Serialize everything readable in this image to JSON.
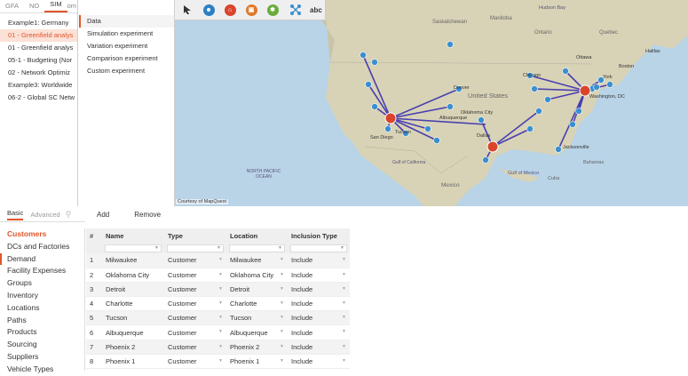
{
  "scenario_panel": {
    "tabs": [
      "GFA",
      "NO",
      "SIM",
      "om"
    ],
    "items": [
      "Example1: Germany",
      "01 - Greenfield analys",
      "01 - Greenfield analys",
      "05-1 - Budgeting (Nor",
      "02 - Network Optimiz",
      "Example3: Worldwide",
      "06-2 - Global SC Netw"
    ]
  },
  "experiments": [
    "Data",
    "Simulation experiment",
    "Variation experiment",
    "Comparison experiment",
    "Custom experiment"
  ],
  "map": {
    "toolbar_text": "abc",
    "courtesy": "Courtesy of MapQuest",
    "labels": [
      "Denver",
      "Oklahoma City",
      "Albuquerque",
      "Dallas",
      "Chicago",
      "Washington, DC",
      "York",
      "Jacksonville",
      "Tucson",
      "Ottawa",
      "Boston",
      "Halifax",
      "San Diego"
    ],
    "regions": [
      "Saskatchewan",
      "Manitoba",
      "Ontario",
      "Quebec",
      "NORTH PACIFIC OCEAN",
      "United States",
      "Mexico",
      "Gulf of Mexico",
      "Cuba",
      "Bahamas",
      "Gulf of California",
      "Hudson Bay"
    ]
  },
  "bottom_tabs": {
    "basic": "Basic",
    "advanced": "Advanced"
  },
  "tables_list": [
    "Customers",
    "DCs and Factories",
    "Demand",
    "Facility Expenses",
    "Groups",
    "Inventory",
    "Locations",
    "Paths",
    "Products",
    "Sourcing",
    "Suppliers",
    "Vehicle Types"
  ],
  "grid_actions": {
    "add": "Add",
    "remove": "Remove"
  },
  "grid": {
    "columns": [
      "#",
      "Name",
      "Type",
      "Location",
      "Inclusion Type"
    ],
    "rows": [
      {
        "n": "1",
        "name": "Milwaukee",
        "type": "Customer",
        "location": "Milwaukee",
        "incl": "Include"
      },
      {
        "n": "2",
        "name": "Oklahoma City",
        "type": "Customer",
        "location": "Oklahoma City",
        "incl": "Include"
      },
      {
        "n": "3",
        "name": "Detroit",
        "type": "Customer",
        "location": "Detroit",
        "incl": "Include"
      },
      {
        "n": "4",
        "name": "Charlotte",
        "type": "Customer",
        "location": "Charlotte",
        "incl": "Include"
      },
      {
        "n": "5",
        "name": "Tucson",
        "type": "Customer",
        "location": "Tucson",
        "incl": "Include"
      },
      {
        "n": "6",
        "name": "Albuquerque",
        "type": "Customer",
        "location": "Albuquerque",
        "incl": "Include"
      },
      {
        "n": "7",
        "name": "Phoenix 2",
        "type": "Customer",
        "location": "Phoenix 2",
        "incl": "Include"
      },
      {
        "n": "8",
        "name": "Phoenix 1",
        "type": "Customer",
        "location": "Phoenix 1",
        "incl": "Include"
      }
    ]
  },
  "colors": {
    "accent": "#e0562b",
    "route": "#4a3fb0",
    "customer": "#3a8fd0",
    "dc": "#d9452b",
    "water": "#b9d3e7",
    "land": "#d6d2b8"
  }
}
